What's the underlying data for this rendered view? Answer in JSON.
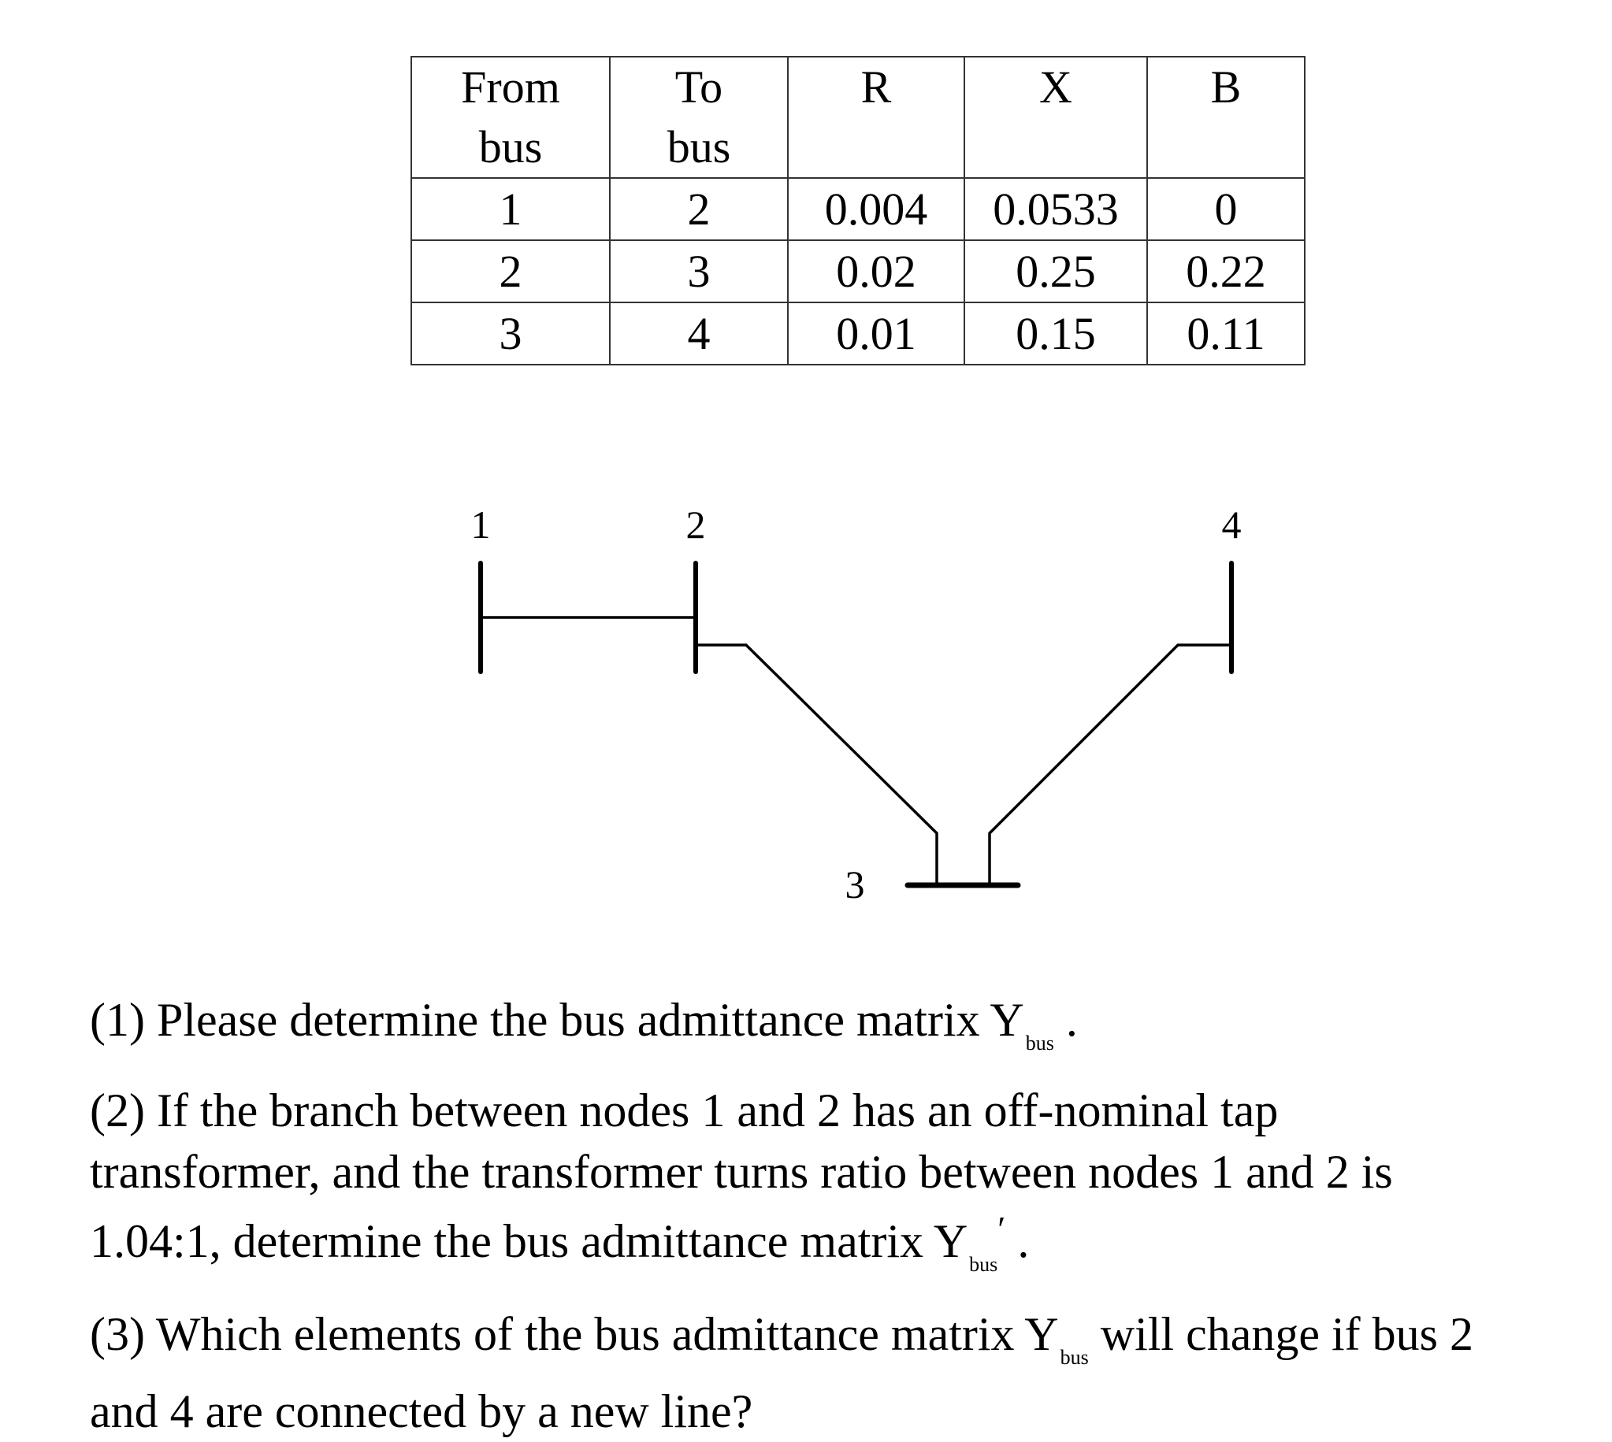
{
  "table": {
    "headers": [
      {
        "line1": "From",
        "line2": "bus"
      },
      {
        "line1": "To",
        "line2": "bus"
      },
      {
        "line1": "R",
        "line2": ""
      },
      {
        "line1": "X",
        "line2": ""
      },
      {
        "line1": "B",
        "line2": ""
      }
    ],
    "rows": [
      [
        "1",
        "2",
        "0.004",
        "0.0533",
        "0"
      ],
      [
        "2",
        "3",
        "0.02",
        "0.25",
        "0.22"
      ],
      [
        "3",
        "4",
        "0.01",
        "0.15",
        "0.11"
      ]
    ]
  },
  "diagram": {
    "buses": [
      {
        "id": "1",
        "label": "1"
      },
      {
        "id": "2",
        "label": "2"
      },
      {
        "id": "3",
        "label": "3"
      },
      {
        "id": "4",
        "label": "4"
      }
    ],
    "lines": [
      {
        "from": "1",
        "to": "2"
      },
      {
        "from": "2",
        "to": "3"
      },
      {
        "from": "3",
        "to": "4"
      }
    ]
  },
  "questions": {
    "q1": {
      "text": "(1) Please determine the bus admittance matrix ",
      "symbol": "Y",
      "subscript": "bus",
      "suffix": " ."
    },
    "q2": {
      "line1": "(2) If the branch between nodes 1 and 2 has an off-nominal tap",
      "line2": "transformer, and the transformer turns ratio between nodes 1 and 2 is",
      "line3_prefix": "1.04:1, determine the bus admittance matrix  ",
      "symbol": "Y",
      "subscript": "bus",
      "prime": "′",
      "suffix": " ."
    },
    "q3": {
      "line1_prefix": "(3) Which elements of the bus admittance matrix  ",
      "symbol": "Y",
      "subscript": "bus",
      "line1_suffix": "  will change if bus 2",
      "line2": "and 4 are connected by a new line?"
    }
  }
}
